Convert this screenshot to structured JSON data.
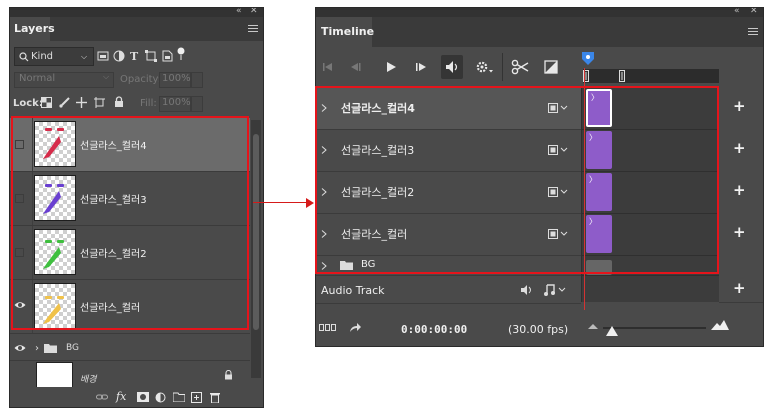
{
  "layers_panel": {
    "title": "Layers",
    "filter_kind": "Kind",
    "blend_mode": "Normal",
    "opacity_label": "Opacity:",
    "opacity_value": "100%",
    "lock_label": "Lock:",
    "fill_label": "Fill:",
    "fill_value": "100%",
    "layers": [
      {
        "name": "선글라스_컬러4",
        "visible": false,
        "selected": true,
        "art_color": "#d62b4a"
      },
      {
        "name": "선글라스_컬러3",
        "visible": false,
        "selected": false,
        "art_color": "#6a3fd1"
      },
      {
        "name": "선글라스_컬러2",
        "visible": false,
        "selected": false,
        "art_color": "#3fbf3f"
      },
      {
        "name": "선글라스_컬러",
        "visible": true,
        "selected": false,
        "art_color": "#f0c24a"
      }
    ],
    "group": {
      "name": "BG"
    },
    "background_layer": {
      "name": "배경"
    }
  },
  "timeline_panel": {
    "title": "Timeline",
    "tracks": [
      {
        "name": "선글라스_컬러4",
        "bold": true
      },
      {
        "name": "선글라스_컬러3",
        "bold": false
      },
      {
        "name": "선글라스_컬러2",
        "bold": false
      },
      {
        "name": "선글라스_컬러",
        "bold": false
      }
    ],
    "group_track": "BG",
    "audio_track": "Audio Track",
    "timecode": "0:00:00:00",
    "fps": "(30.00 fps)",
    "clip_color": "#8e5cc9",
    "highlight_color": "#e5141b"
  }
}
